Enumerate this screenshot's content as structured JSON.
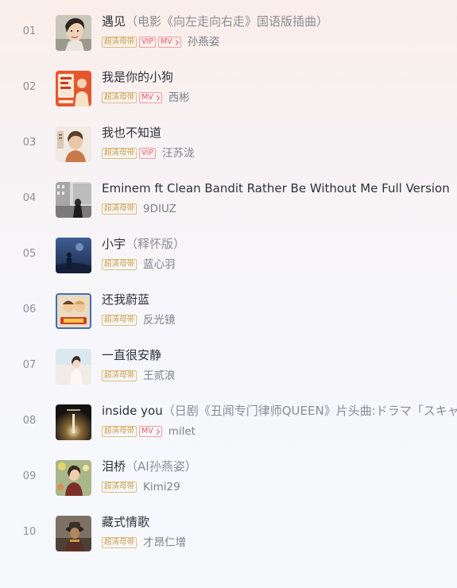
{
  "songs": [
    {
      "index": "01",
      "title": "遇见",
      "subtitle": "（电影《向左走向右走》国语版插曲）",
      "tags": [
        "超清母带",
        "VIP",
        "MV"
      ],
      "artist": "孙燕姿",
      "cover": "woman-portrait-cover"
    },
    {
      "index": "02",
      "title": "我是你的小狗",
      "subtitle": "",
      "tags": [
        "超清母带",
        "MV"
      ],
      "artist": "西彬",
      "cover": "orange-poster-cover"
    },
    {
      "index": "03",
      "title": "我也不知道",
      "subtitle": "",
      "tags": [
        "超清母带",
        "VIP"
      ],
      "artist": "汪苏泷",
      "cover": "man-portrait-cover"
    },
    {
      "index": "04",
      "title": "Eminem ft Clean Bandit Rather Be Without Me Full Version",
      "subtitle": "",
      "tags": [
        "超清母带"
      ],
      "artist": "9DIUZ",
      "cover": "city-street-cover"
    },
    {
      "index": "05",
      "title": "小宇",
      "subtitle": "（释怀版）",
      "tags": [
        "超清母带"
      ],
      "artist": "蓝心羽",
      "cover": "blue-night-cover"
    },
    {
      "index": "06",
      "title": "还我蔚蓝",
      "subtitle": "",
      "tags": [
        "超清母带"
      ],
      "artist": "反光镜",
      "cover": "cartoon-band-cover"
    },
    {
      "index": "07",
      "title": "一直很安静",
      "subtitle": "",
      "tags": [
        "超清母带"
      ],
      "artist": "王贰浪",
      "cover": "pale-girl-cover"
    },
    {
      "index": "08",
      "title": "inside you",
      "subtitle": "（日剧《丑闻专门律师QUEEN》片头曲:ドラマ「スキャンダル専門弁護士QUEEN」オープニングテーマ）",
      "tags": [
        "超清母带",
        "MV"
      ],
      "artist": "milet",
      "cover": "dark-light-cover"
    },
    {
      "index": "09",
      "title": "泪桥",
      "subtitle": "（AI孙燕姿）",
      "tags": [
        "超清母带"
      ],
      "artist": "Kimi29",
      "cover": "girl-flowers-cover"
    },
    {
      "index": "10",
      "title": "藏式情歌",
      "subtitle": "",
      "tags": [
        "超清母带"
      ],
      "artist": "才昂仁增",
      "cover": "tibetan-man-cover"
    }
  ]
}
